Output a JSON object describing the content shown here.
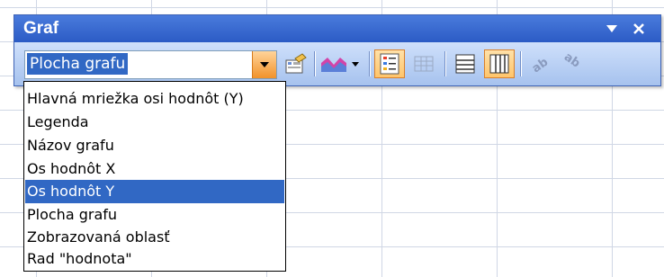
{
  "window": {
    "title": "Graf",
    "colors": {
      "title_bg": "#2c5bc5",
      "selection": "#3168c4",
      "active_button": "#ffc56b"
    }
  },
  "toolbar": {
    "combo_value": "Plocha grafu",
    "buttons": [
      {
        "icon": "format-object-icon",
        "active": false
      },
      {
        "icon": "chart-type-icon",
        "active": false,
        "has_dropdown": true
      },
      {
        "icon": "legend-icon",
        "active": true
      },
      {
        "icon": "data-table-icon",
        "active": false,
        "disabled": true
      },
      {
        "icon": "by-row-icon",
        "active": false
      },
      {
        "icon": "by-column-icon",
        "active": true
      },
      {
        "icon": "angle-clockwise-icon",
        "active": false,
        "disabled": true
      },
      {
        "icon": "angle-counterclockwise-icon",
        "active": false,
        "disabled": true
      }
    ]
  },
  "dropdown": {
    "items": [
      "Hlavná mriežka osi hodnôt (Y)",
      "Legenda",
      "Názov grafu",
      "Os hodnôt X",
      "Os hodnôt Y",
      "Plocha grafu",
      "Zobrazovaná oblasť",
      "Rad \"hodnota\""
    ],
    "selected": "Os hodnôt Y"
  }
}
